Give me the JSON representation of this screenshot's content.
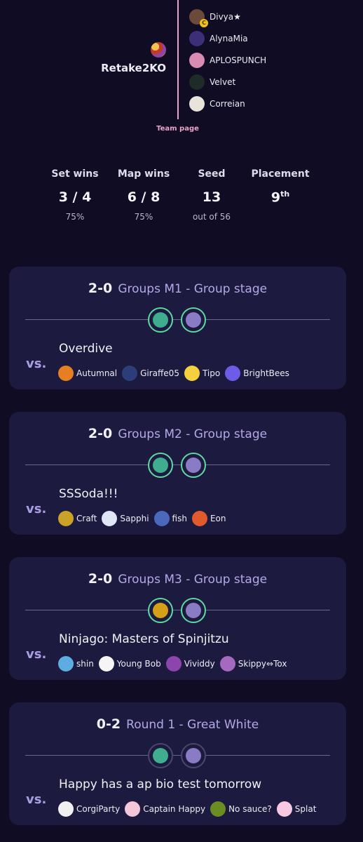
{
  "team": {
    "name": "Retake2KO",
    "team_page_link": "Team page",
    "members": [
      {
        "name": "Divya★",
        "avatar_color": "#6b4a3a",
        "has_badge": true,
        "badge": "C"
      },
      {
        "name": "AlynaMia",
        "avatar_color": "#3c2f78",
        "has_badge": false
      },
      {
        "name": "APLOSPUNCH",
        "avatar_color": "#d98bb3",
        "has_badge": false
      },
      {
        "name": "Velvet",
        "avatar_color": "#1f2b26",
        "has_badge": false
      },
      {
        "name": "Correian",
        "avatar_color": "#e8e4dc",
        "has_badge": false
      }
    ]
  },
  "stats": [
    {
      "label": "Set wins",
      "value": "3 / 4",
      "sub": "75%"
    },
    {
      "label": "Map wins",
      "value": "6 / 8",
      "sub": "75%"
    },
    {
      "label": "Seed",
      "value": "13",
      "sub": "out of 56"
    },
    {
      "label": "Placement",
      "value": "9",
      "value_suffix": "th",
      "sub": ""
    }
  ],
  "matches": [
    {
      "score": "2-0",
      "round": "Groups M1 - Group stage",
      "maps": [
        {
          "result": "win",
          "color": "#3fae8e"
        },
        {
          "result": "win",
          "color": "#8a7bc4"
        }
      ],
      "opponent": "Overdive",
      "players": [
        {
          "name": "Autumnal",
          "color": "#e67e22"
        },
        {
          "name": "Giraffe05",
          "color": "#2c3e7a"
        },
        {
          "name": "Tipo",
          "color": "#f4d03f"
        },
        {
          "name": "BrightBees",
          "color": "#6c5ce7"
        }
      ]
    },
    {
      "score": "2-0",
      "round": "Groups M2 - Group stage",
      "maps": [
        {
          "result": "win",
          "color": "#3fae8e"
        },
        {
          "result": "win",
          "color": "#8a7bc4"
        }
      ],
      "opponent": "SSSoda!!!",
      "players": [
        {
          "name": "Craft",
          "color": "#c9a227"
        },
        {
          "name": "Sapphi",
          "color": "#dfe6f5"
        },
        {
          "name": "fish",
          "color": "#4a69bd"
        },
        {
          "name": "Eon",
          "color": "#e05a2b"
        }
      ]
    },
    {
      "score": "2-0",
      "round": "Groups M3 - Group stage",
      "maps": [
        {
          "result": "win",
          "color": "#d4a017"
        },
        {
          "result": "win",
          "color": "#8a7bc4"
        }
      ],
      "opponent": "Ninjago: Masters of Spinjitzu",
      "players": [
        {
          "name": "shin",
          "color": "#5dade2"
        },
        {
          "name": "Young Bob",
          "color": "#f5f5f5"
        },
        {
          "name": "Vividdy",
          "color": "#8e44ad"
        },
        {
          "name": "Skippy⇔Tox",
          "color": "#a569bd"
        }
      ]
    },
    {
      "score": "0-2",
      "round": "Round 1 - Great White",
      "maps": [
        {
          "result": "loss",
          "color": "#3fae8e"
        },
        {
          "result": "loss",
          "color": "#8a7bc4"
        }
      ],
      "opponent": "Happy has a ap bio test tomorrow",
      "players": [
        {
          "name": "CorgiParty",
          "color": "#f0f0f0"
        },
        {
          "name": "Captain Happy",
          "color": "#f3c6d8"
        },
        {
          "name": "No sauce?",
          "color": "#6b8e23"
        },
        {
          "name": "Splat",
          "color": "#f7c8e0"
        }
      ]
    }
  ]
}
